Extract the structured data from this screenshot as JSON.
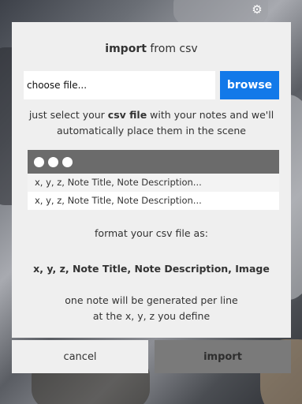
{
  "header": {
    "settings_icon": "gear-icon"
  },
  "dialog": {
    "title_bold": "import",
    "title_rest": " from csv",
    "file_input": {
      "value": "choose file..."
    },
    "browse_label": "browse",
    "instruction": {
      "before": "just select your ",
      "bold": "csv file",
      "after": " with your notes and we'll automatically place them in the scene"
    },
    "preview": {
      "header_icon": "window-dots-icon",
      "rows": [
        "x, y, z, Note Title, Note Description...",
        "x, y, z, Note Title, Note Description..."
      ]
    },
    "format_label": "format your csv file as:",
    "format_example": "x, y, z, Note Title, Note Description, Image",
    "footnote_line1": "one note will be generated per line",
    "footnote_line2": "at the x, y, z you define"
  },
  "actions": {
    "cancel_label": "cancel",
    "import_label": "import"
  },
  "colors": {
    "accent": "#1279e9",
    "dialog_bg": "#efefef",
    "import_button_bg": "#7a7a7a"
  }
}
